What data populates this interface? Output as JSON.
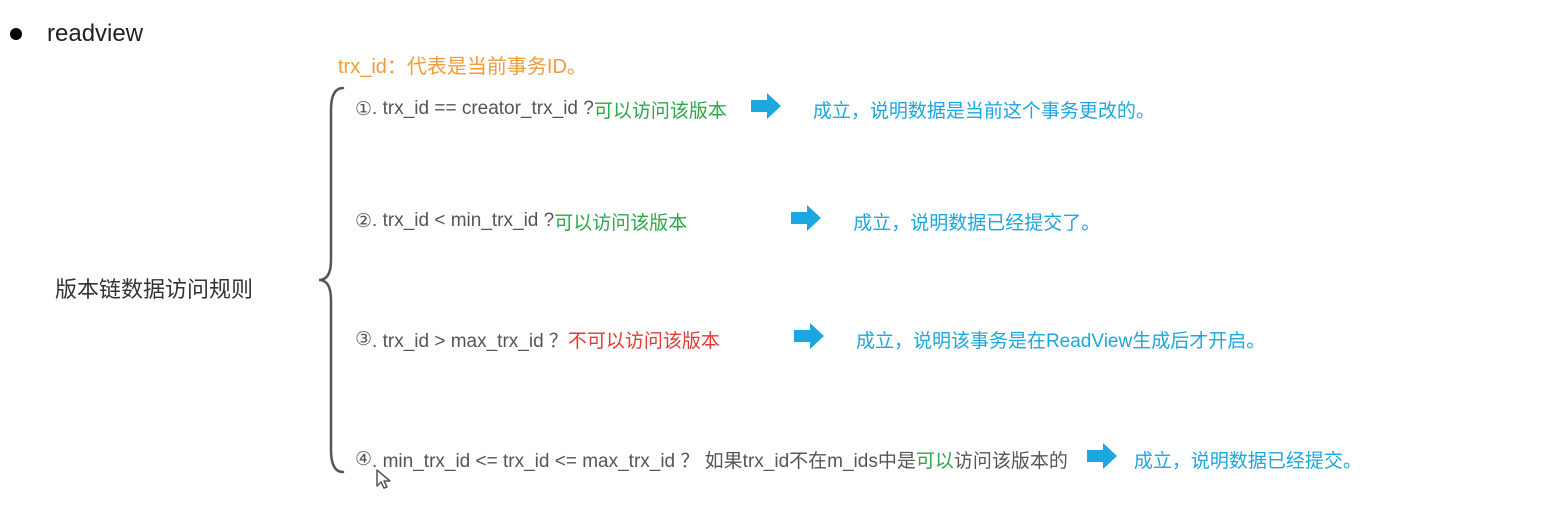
{
  "header": {
    "title": "readview"
  },
  "subtitle": "trx_id：代表是当前事务ID。",
  "ruleLabel": "版本链数据访问规则",
  "rules": [
    {
      "num": "①",
      "condition": ". trx_id  == creator_trx_id ? ",
      "result": "可以访问该版本",
      "resultColor": "green",
      "explanation": "成立，说明数据是当前这个事务更改的。"
    },
    {
      "num": "②",
      "condition": ". trx_id < min_trx_id ? ",
      "result": "可以访问该版本",
      "resultColor": "green",
      "explanation": "成立，说明数据已经提交了。"
    },
    {
      "num": "③",
      "condition": ". trx_id > max_trx_id ？ ",
      "result": "不可以访问该版本",
      "resultColor": "red",
      "explanation": "成立，说明该事务是在ReadView生成后才开启。"
    },
    {
      "num": "④",
      "condition": ". min_trx_id <= trx_id <= max_trx_id ？ 如果trx_id不在m_ids中是",
      "result": "可以",
      "resultSuffix": "访问该版本的",
      "resultColor": "green",
      "explanation": "成立，说明数据已经提交。"
    }
  ]
}
